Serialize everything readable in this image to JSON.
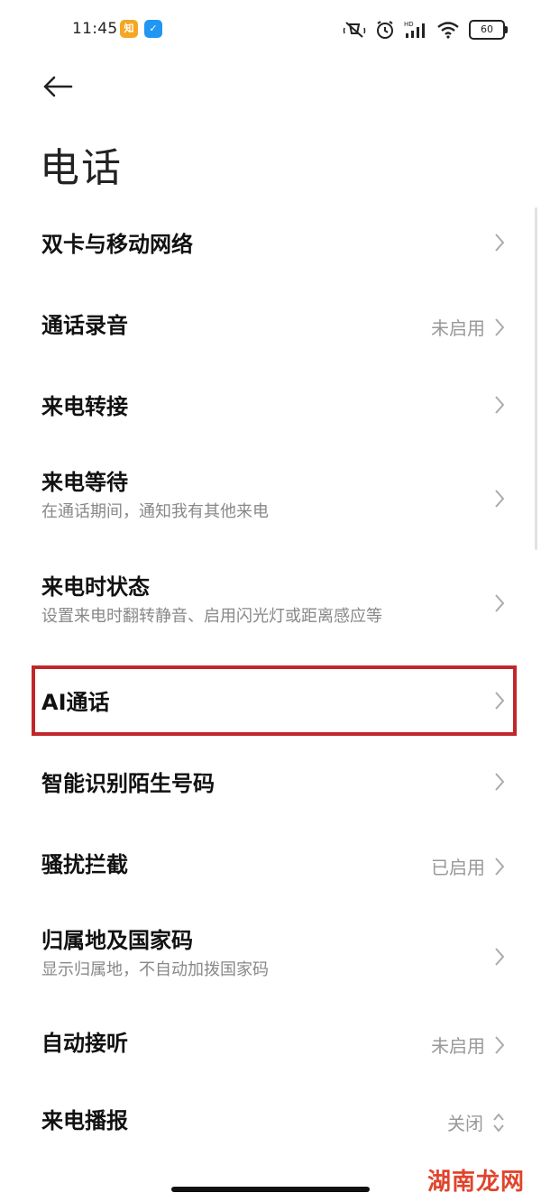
{
  "status_bar": {
    "time": "11:45",
    "app_icon_1": "知",
    "app_icon_2": "✓",
    "battery": "60",
    "icons": [
      "mute-vibrate-icon",
      "alarm-icon",
      "hd-signal-icon",
      "wifi-icon",
      "battery-icon"
    ]
  },
  "header": {
    "title": "电话"
  },
  "settings": {
    "items": [
      {
        "title": "双卡与移动网络",
        "subtitle": "",
        "status": ""
      },
      {
        "title": "通话录音",
        "subtitle": "",
        "status": "未启用"
      },
      {
        "title": "来电转接",
        "subtitle": "",
        "status": ""
      },
      {
        "title": "来电等待",
        "subtitle": "在通话期间，通知我有其他来电",
        "status": ""
      },
      {
        "title": "来电时状态",
        "subtitle": "设置来电时翻转静音、启用闪光灯或距离感应等",
        "status": ""
      },
      {
        "title": "AI通话",
        "subtitle": "",
        "status": ""
      },
      {
        "title": "智能识别陌生号码",
        "subtitle": "",
        "status": ""
      },
      {
        "title": "骚扰拦截",
        "subtitle": "",
        "status": "已启用"
      },
      {
        "title": "归属地及国家码",
        "subtitle": "显示归属地，不自动加拨国家码",
        "status": ""
      },
      {
        "title": "自动接听",
        "subtitle": "",
        "status": "未启用"
      },
      {
        "title": "来电播报",
        "subtitle": "",
        "status": "关闭"
      }
    ]
  },
  "watermark": "湖南龙网",
  "colors": {
    "highlight": "#c0262a",
    "text_primary": "#111111",
    "text_secondary": "#888888"
  }
}
